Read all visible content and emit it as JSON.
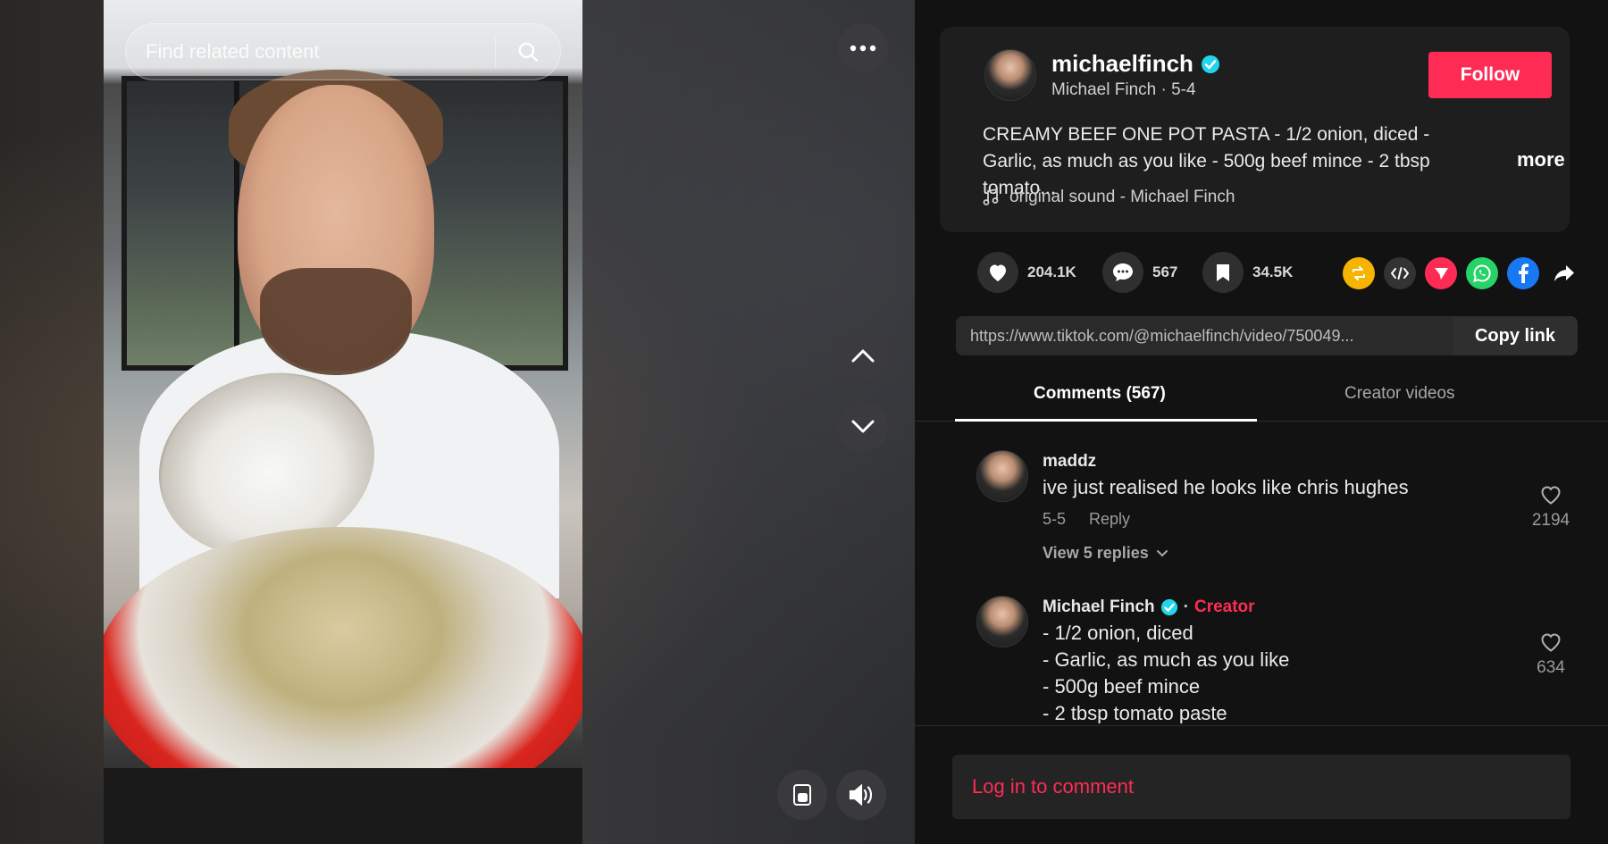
{
  "search": {
    "placeholder": "Find related content"
  },
  "video_controls": {
    "more_icon": "more-horizontal-icon",
    "up_icon": "chevron-up-icon",
    "down_icon": "chevron-down-icon",
    "pip_icon": "picture-in-picture-icon",
    "volume_icon": "volume-icon"
  },
  "creator": {
    "username": "michaelfinch",
    "display_name": "Michael Finch",
    "date": "5-4",
    "separator": "·",
    "follow_label": "Follow"
  },
  "post": {
    "caption": "CREAMY BEEF ONE POT PASTA - 1/2 onion, diced - Garlic, as much as you like - 500g beef mince - 2 tbsp tomato...",
    "more_label": "more",
    "sound": "original sound - Michael Finch"
  },
  "stats": {
    "likes": "204.1K",
    "comments": "567",
    "saves": "34.5K"
  },
  "share": {
    "icons": [
      "repost-icon",
      "embed-icon",
      "send-icon",
      "whatsapp-icon",
      "facebook-icon",
      "share-arrow-icon"
    ]
  },
  "link": {
    "url": "https://www.tiktok.com/@michaelfinch/video/750049...",
    "copy_label": "Copy link"
  },
  "tabs": [
    {
      "label": "Comments (567)"
    },
    {
      "label": "Creator videos"
    }
  ],
  "comments": [
    {
      "name": "maddz",
      "text": "ive just realised he looks like chris hughes",
      "date": "5-5",
      "reply_label": "Reply",
      "likes": "2194",
      "view_replies": "View 5 replies"
    },
    {
      "name": "Michael Finch",
      "creator_label": "Creator",
      "lines": [
        "- 1/2 onion, diced",
        "- Garlic, as much as you like",
        "- 500g beef mince",
        "- 2 tbsp tomato paste"
      ],
      "likes": "634"
    }
  ],
  "footer": {
    "login_label": "Log in to comment"
  },
  "colors": {
    "accent": "#fe2c55",
    "verified": "#20d5ec",
    "background": "#121212"
  }
}
